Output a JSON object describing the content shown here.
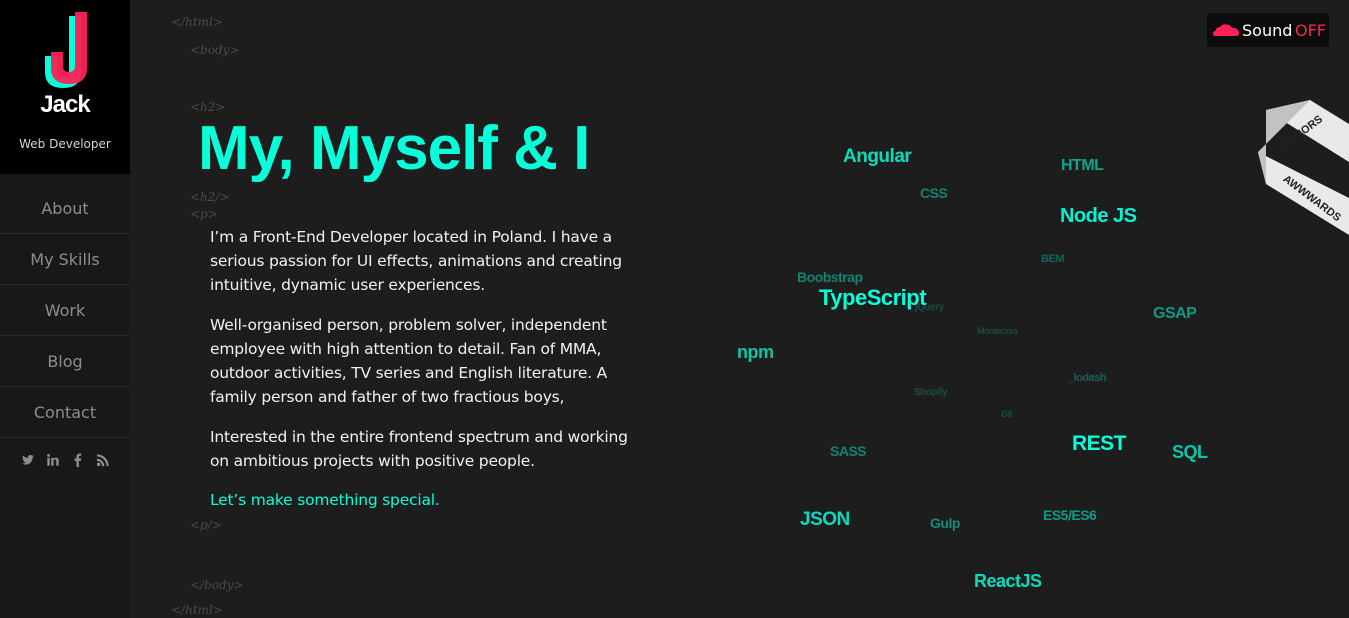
{
  "sidebar": {
    "logo": {
      "letter": "J",
      "name": "Jack",
      "role": "Web Developer"
    },
    "nav": [
      {
        "label": "About"
      },
      {
        "label": "My Skills"
      },
      {
        "label": "Work"
      },
      {
        "label": "Blog"
      },
      {
        "label": "Contact"
      }
    ],
    "social": [
      "twitter-icon",
      "linkedin-icon",
      "facebook-icon",
      "rss-icon"
    ]
  },
  "code_tags": {
    "html_close_top": "</html>",
    "body_open": "<body>",
    "h2_open": "<h2>",
    "h2_close": "<h2/>",
    "p_open": "<p>",
    "p_close": "<p/>",
    "body_close": "</body>",
    "html_close_bottom": "</html>"
  },
  "main": {
    "heading": "My, Myself & I",
    "paragraphs": [
      "I’m a Front-End Developer located in Poland. I have a serious passion for UI effects, animations and creating intuitive, dynamic user experiences.",
      "Well-organised person, problem solver, independent employee with high attention to detail. Fan of MMA, outdoor activities, TV series and English literature. A family person and father of two fractious boys,",
      "Interested in the entire frontend spectrum and working on ambitious projects with positive people."
    ],
    "cta": "Let’s make something special."
  },
  "sound": {
    "label": "Sound",
    "state": "OFF",
    "icon": "soundcloud-icon"
  },
  "ribbon": {
    "top": "HONORS",
    "bottom": "AWWWARDS"
  },
  "skills_cloud": [
    {
      "text": "Angular"
    },
    {
      "text": "HTML"
    },
    {
      "text": "CSS"
    },
    {
      "text": "Node JS"
    },
    {
      "text": "BEM"
    },
    {
      "text": "Boobstrap"
    },
    {
      "text": "TypeScript"
    },
    {
      "text": "jQuery"
    },
    {
      "text": "GSAP"
    },
    {
      "text": "Montecrss"
    },
    {
      "text": "npm"
    },
    {
      "text": "_lodash"
    },
    {
      "text": "Shopify"
    },
    {
      "text": "Git"
    },
    {
      "text": "REST"
    },
    {
      "text": "SASS"
    },
    {
      "text": "SQL"
    },
    {
      "text": "JSON"
    },
    {
      "text": "ES5/ES6"
    },
    {
      "text": "Gulp"
    },
    {
      "text": "ReactJS"
    }
  ],
  "colors": {
    "accent": "#08fdd8",
    "logo_pink": "#fd2155",
    "background": "#1d1d1d",
    "sidebar": "#181818"
  }
}
